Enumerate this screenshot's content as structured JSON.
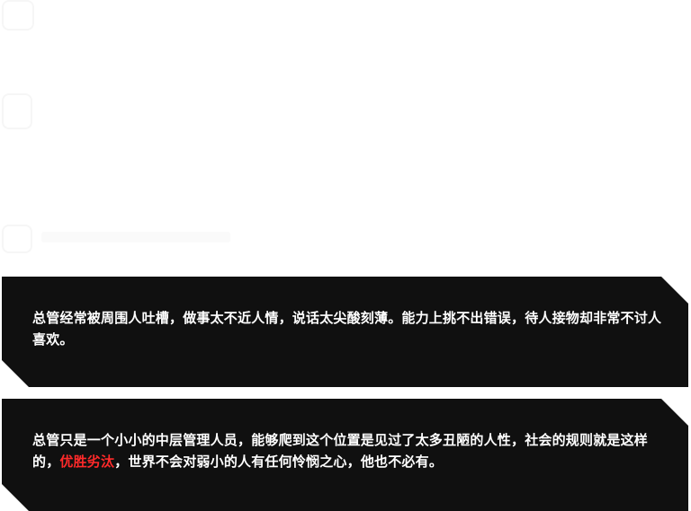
{
  "panels": [
    {
      "text": "总管经常被周围人吐槽，做事太不近人情，说话太尖酸刻薄。能力上挑不出错误，待人接物却非常不讨人喜欢。"
    },
    {
      "text_before": "总管只是一个小小的中层管理人员，能够爬到这个位置是见过了太多丑陋的人性，社会的规则就是这样的，",
      "highlight": "优胜劣汰",
      "text_after": "，世界不会对弱小的人有任何怜悯之心，他也不必有。"
    }
  ],
  "colors": {
    "panel_bg": "#101010",
    "text": "#ffffff",
    "highlight": "#ff2a2a"
  }
}
